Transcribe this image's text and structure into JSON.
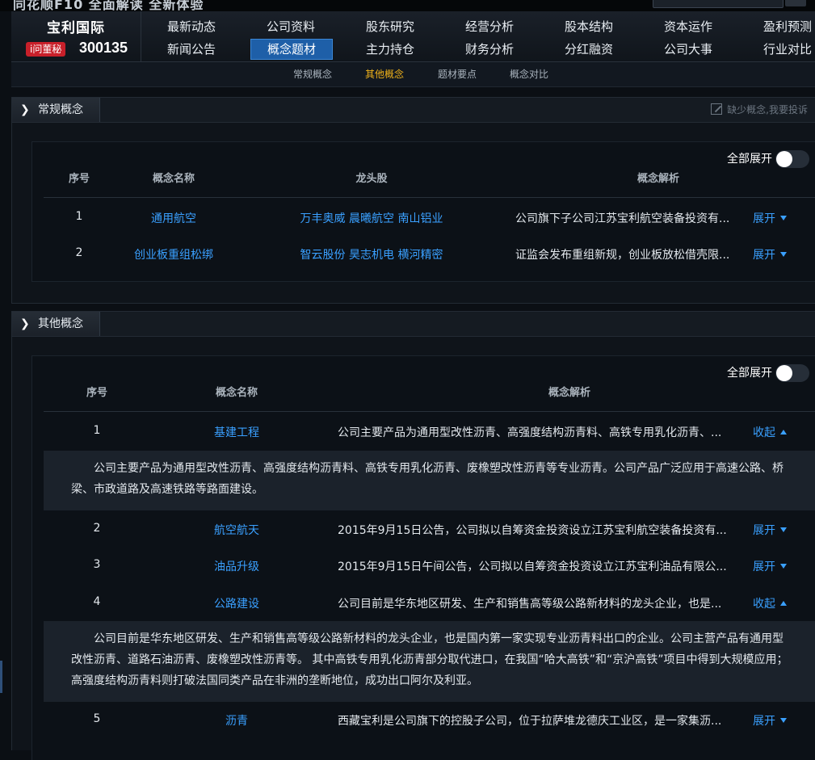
{
  "app": {
    "brand": "同花顺F10",
    "brand_tail": "全面解读 全新体验"
  },
  "stock": {
    "name": "宝利国际",
    "badge": "i问董秘",
    "code": "300135"
  },
  "nav": {
    "row1": [
      "最新动态",
      "公司资料",
      "股东研究",
      "经营分析",
      "股本结构",
      "资本运作",
      "盈利预测"
    ],
    "row2": [
      "新闻公告",
      "概念题材",
      "主力持仓",
      "财务分析",
      "分红融资",
      "公司大事",
      "行业对比"
    ],
    "active": "概念题材"
  },
  "subnav": {
    "items": [
      "常规概念",
      "其他概念",
      "题材要点",
      "概念对比"
    ],
    "active": "其他概念"
  },
  "regular": {
    "title": "常规概念",
    "report": "缺少概念,我要投诉",
    "toggle_label": "全部展开",
    "headers": [
      "序号",
      "概念名称",
      "龙头股",
      "概念解析"
    ],
    "rows": [
      {
        "no": "1",
        "name": "通用航空",
        "leaders": "万丰奥威 晨曦航空 南山铝业",
        "desc": "公司旗下子公司江苏宝利航空装备投资有...",
        "action": "展开"
      },
      {
        "no": "2",
        "name": "创业板重组松绑",
        "leaders": "智云股份 昊志机电 横河精密",
        "desc": "证监会发布重组新规，创业板放松借壳限...",
        "action": "展开"
      }
    ]
  },
  "other": {
    "title": "其他概念",
    "toggle_label": "全部展开",
    "headers": [
      "序号",
      "概念名称",
      "概念解析"
    ],
    "rows": [
      {
        "no": "1",
        "name": "基建工程",
        "desc": "公司主要产品为通用型改性沥青、高强度结构沥青料、高铁专用乳化沥青、...",
        "action": "收起",
        "detail": "公司主要产品为通用型改性沥青、高强度结构沥青料、高铁专用乳化沥青、废橡塑改性沥青等专业沥青。公司产品广泛应用于高速公路、桥梁、市政道路及高速铁路等路面建设。"
      },
      {
        "no": "2",
        "name": "航空航天",
        "desc": "2015年9月15日公告，公司拟以自筹资金投资设立江苏宝利航空装备投资有...",
        "action": "展开"
      },
      {
        "no": "3",
        "name": "油品升级",
        "desc": "2015年9月15日午间公告，公司拟以自筹资金投资设立江苏宝利油品有限公...",
        "action": "展开"
      },
      {
        "no": "4",
        "name": "公路建设",
        "desc": "公司目前是华东地区研发、生产和销售高等级公路新材料的龙头企业，也是...",
        "action": "收起",
        "detail": "公司目前是华东地区研发、生产和销售高等级公路新材料的龙头企业，也是国内第一家实现专业沥青料出口的企业。公司主营产品有通用型改性沥青、道路石油沥青、废橡塑改性沥青等。 其中高铁专用乳化沥青部分取代进口，在我国“哈大高铁”和“京沪高铁”项目中得到大规模应用；高强度结构沥青料则打破法国同类产品在非洲的垄断地位，成功出口阿尔及利亚。"
      },
      {
        "no": "5",
        "name": "沥青",
        "desc": "西藏宝利是公司旗下的控股子公司，位于拉萨堆龙德庆工业区，是一家集沥...",
        "action": "展开"
      }
    ]
  },
  "colors": {
    "accent": "#3aa0ff",
    "active_nav": "#1e5fa8",
    "active_sub": "#f0b21a",
    "badge": "#c8202a"
  }
}
